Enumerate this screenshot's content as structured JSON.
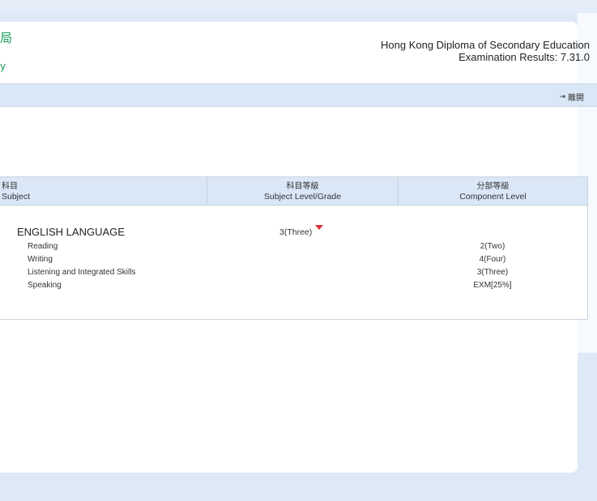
{
  "header": {
    "logo_glyph": "局",
    "logo_sub": "y",
    "title_line1": "Hong Kong Diploma of Secondary Education",
    "title_line2": "Examination Results: 7.31.0"
  },
  "toolbar": {
    "logout_label": "離開",
    "logout_icon": "logout-arrow-icon"
  },
  "table": {
    "headers": {
      "subject_zh": "科目",
      "subject_en": "Subject",
      "level_zh": "科目等級",
      "level_en": "Subject Level/Grade",
      "component_zh": "分部等級",
      "component_en": "Component Level"
    },
    "subject": {
      "name": "ENGLISH LANGUAGE",
      "grade": "3(Three)",
      "components": [
        {
          "name": "Reading",
          "level": "2(Two)"
        },
        {
          "name": "Writing",
          "level": "4(Four)"
        },
        {
          "name": "Listening and Integrated Skills",
          "level": "3(Three)"
        },
        {
          "name": "Speaking",
          "level": "EXM[25%]"
        }
      ]
    }
  },
  "colors": {
    "accent_green": "#1a9a5a",
    "header_bg": "#d9e7f7",
    "arrow_red": "#d9343a"
  }
}
